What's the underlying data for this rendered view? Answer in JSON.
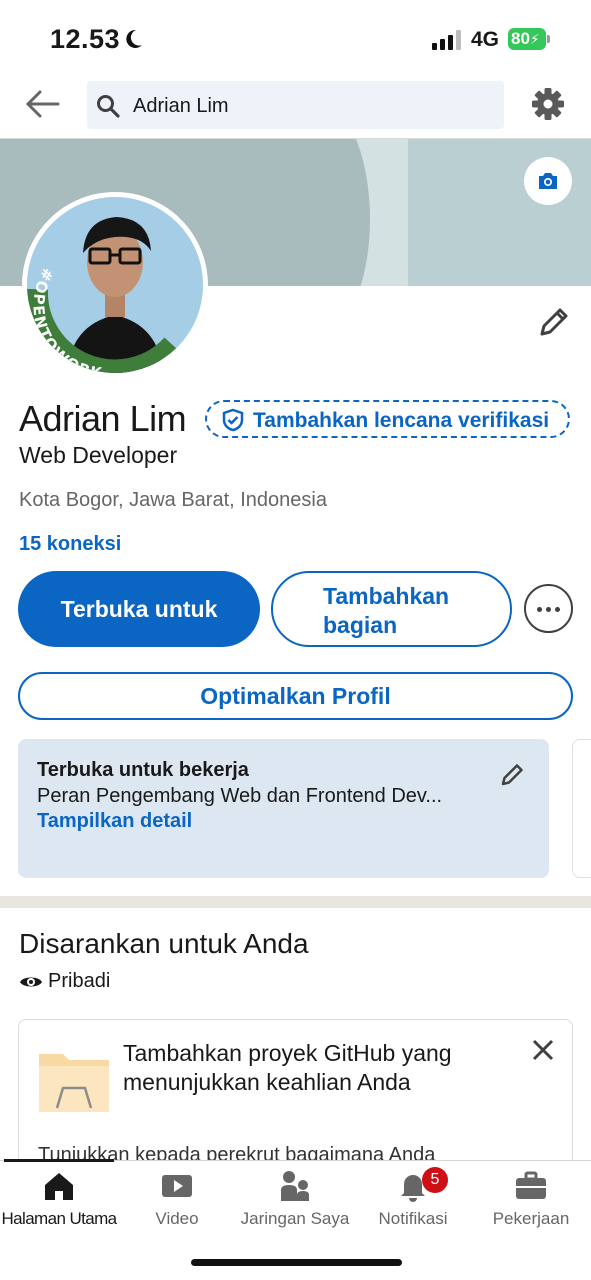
{
  "status_bar": {
    "time": "12.53",
    "network": "4G",
    "battery": "80"
  },
  "search": {
    "value": "Adrian Lim"
  },
  "profile": {
    "name": "Adrian Lim",
    "verify_badge_label": "Tambahkan lencana verifikasi",
    "headline": "Web Developer",
    "location": "Kota Bogor, Jawa Barat, Indonesia",
    "connections": "15 koneksi",
    "frame_text": "#OPENTOWORK"
  },
  "actions": {
    "open_to": "Terbuka untuk",
    "add_section": "Tambahkan bagian",
    "optimize": "Optimalkan Profil"
  },
  "open_to_work": {
    "title": "Terbuka untuk bekerja",
    "roles": "Peran Pengembang Web dan Frontend Dev...",
    "details_link": "Tampilkan detail"
  },
  "suggested": {
    "title": "Disarankan untuk Anda",
    "privacy": "Pribadi",
    "card_title": "Tambahkan proyek GitHub yang menunjukkan keahlian Anda",
    "card_desc": "Tunjukkan kepada perekrut bagaimana Anda"
  },
  "bottom_nav": [
    {
      "label": "Halaman Utama",
      "icon": "home-icon",
      "active": true
    },
    {
      "label": "Video",
      "icon": "video-icon"
    },
    {
      "label": "Jaringan Saya",
      "icon": "network-icon"
    },
    {
      "label": "Notifikasi",
      "icon": "bell-icon",
      "badge": "5"
    },
    {
      "label": "Pekerjaan",
      "icon": "briefcase-icon"
    }
  ],
  "colors": {
    "brand": "#0a66c2",
    "frame_green": "#3f7d3a",
    "battery": "#34c759",
    "badge": "#cc1016"
  }
}
